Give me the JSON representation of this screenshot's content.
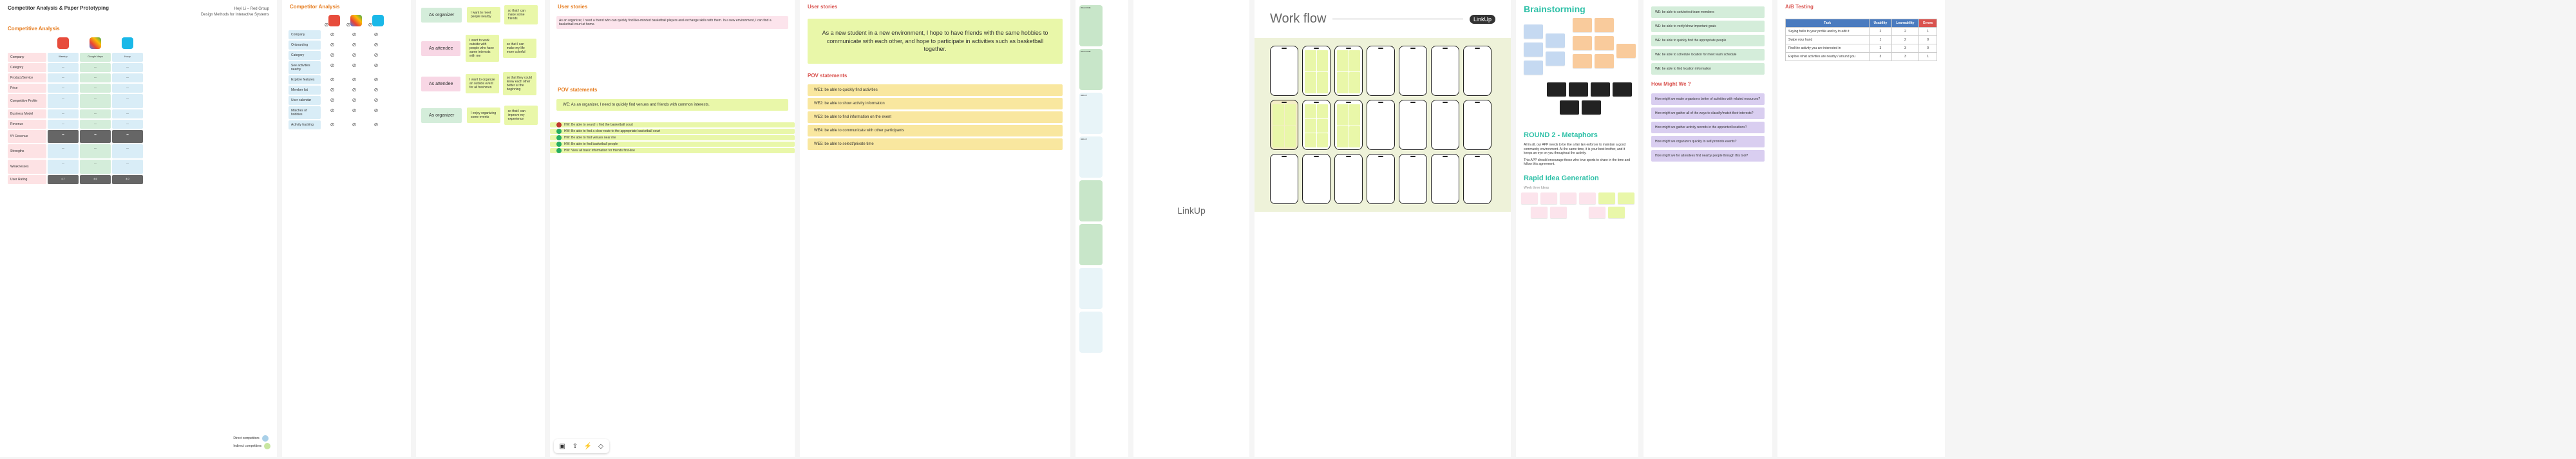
{
  "p1": {
    "title": "Competitor Analysis & Paper Prototyping",
    "byline_name": "Heyi Li – Red Group",
    "byline_course": "Design Methods for Interactive Systems",
    "section": "Competitive Analysis",
    "rows": [
      "Company",
      "Category",
      "Product/Service",
      "Price",
      "Competitive Profile",
      "Business Model",
      "Revenue",
      "5Y Revenue",
      "Strengths",
      "Weaknesses",
      "User Rating"
    ],
    "apps": [
      "Meetup",
      "Google Maps",
      "Hoop"
    ],
    "legend_direct": "Direct competitors",
    "legend_indirect": "Indirect competitors",
    "ratings": [
      "4.7",
      "4.6",
      "4.0"
    ]
  },
  "p2": {
    "section": "Competitor Analysis",
    "rows": [
      "Company",
      "Onboarding",
      "Category",
      "See activities nearby",
      "Explore features",
      "Member list",
      "User calendar",
      "Matches of hobbies",
      "Activity tracking"
    ]
  },
  "p3": {
    "roles": [
      "As organizer",
      "As attendee",
      "As attendee",
      "As organizer"
    ],
    "notes": [
      "I want to meet people nearby",
      "so that I can make some friends",
      "I want to work outside with people who have same interests with me",
      "so that I can make my life more colorful",
      "I want to organize an outside event for all freshmen",
      "so that they could know each other better at the beginning",
      "I enjoy organizing some events",
      "so that I can improve my experience"
    ]
  },
  "p4": {
    "user_stories_title": "User stories",
    "user_story": "As an organizer, I need a friend who can quickly find like-minded basketball players and exchange skills with them. In a new environment, I can find a basketball court at home.",
    "pov_title": "POV statements",
    "pov_main": "WE: As an organizer, I need to quickly find venues and friends with common interests.",
    "hmw_bullets": [
      "HW: Be able to search / find the basketball court",
      "HW: Be able to find a clear route to the appropriate basketball court",
      "HW: Be able to find venues near me",
      "HW: Be able to find basketball people",
      "HW: View all basic information for friends first-line"
    ],
    "toolbar": [
      "image-icon",
      "share-icon",
      "bolt-icon",
      "tag-icon"
    ]
  },
  "p5": {
    "user_stories_title": "User stories",
    "big_story": "As a new student in a new environment, I hope to have friends with the same hobbies to communicate with each other, and hope to participate in activities such as basketball together.",
    "pov_title": "POV statements",
    "wes": [
      "WE1: be able to quickly find activities",
      "WE2: be able to show activity information",
      "WE3: be able to find information on the event",
      "WE4: be able to communicate with other participants",
      "WE5: be able to select/private time"
    ]
  },
  "p6": {
    "mocks": [
      "WELCOME",
      "WELCOME",
      "HELLO",
      "HELLO"
    ]
  },
  "p7": {
    "title": "LinkUp"
  },
  "p8": {
    "title": "Work flow",
    "badge": "LinkUp"
  },
  "p9": {
    "title": "Brainstorming",
    "round2_title": "ROUND 2 - Metaphors",
    "round2_text": "All in all, our APP needs to be like a fair law enforcer to maintain a good community environment. At the same time, it is your best brother, and it keeps an eye on you throughout the activity.",
    "round2_text2": "This APP should encourage those who love sports to share in the time and follow this agreement.",
    "rapid_title": "Rapid Idea Generation",
    "rapid_sub": "Week three Ideas"
  },
  "p10": {
    "hmw_green": [
      "WE: be able to sort/select team members",
      "WE: be able to verify/show important goals",
      "WE: be able to quickly find the appropriate people",
      "WE: be able to schedule location for meet team schedule",
      "WE: be able to find location information"
    ],
    "hmw_title": "How Might We ?",
    "hmw_purple": [
      "How might we make organizers better of activities with related resources?",
      "How might we gather all of the ways to classify/match their interests?",
      "How might we gather activity records in the appointed locations?",
      "How might we organizers quickly to self-promote events?",
      "How might we for attendees find nearby people through this tool?"
    ]
  },
  "p11": {
    "title": "A/B Testing",
    "headers": [
      "Task",
      "Usability",
      "Learnability",
      "Errors"
    ],
    "rows": [
      {
        "task": "Saying hello to your profile and try to edit it",
        "u": "2",
        "l": "2",
        "e": "1"
      },
      {
        "task": "Swipe your hand",
        "u": "1",
        "l": "2",
        "e": "0"
      },
      {
        "task": "Find the activity you are interested in",
        "u": "3",
        "l": "3",
        "e": "0"
      },
      {
        "task": "Explore what activities are nearby / around you",
        "u": "3",
        "l": "3",
        "e": "1"
      }
    ]
  }
}
